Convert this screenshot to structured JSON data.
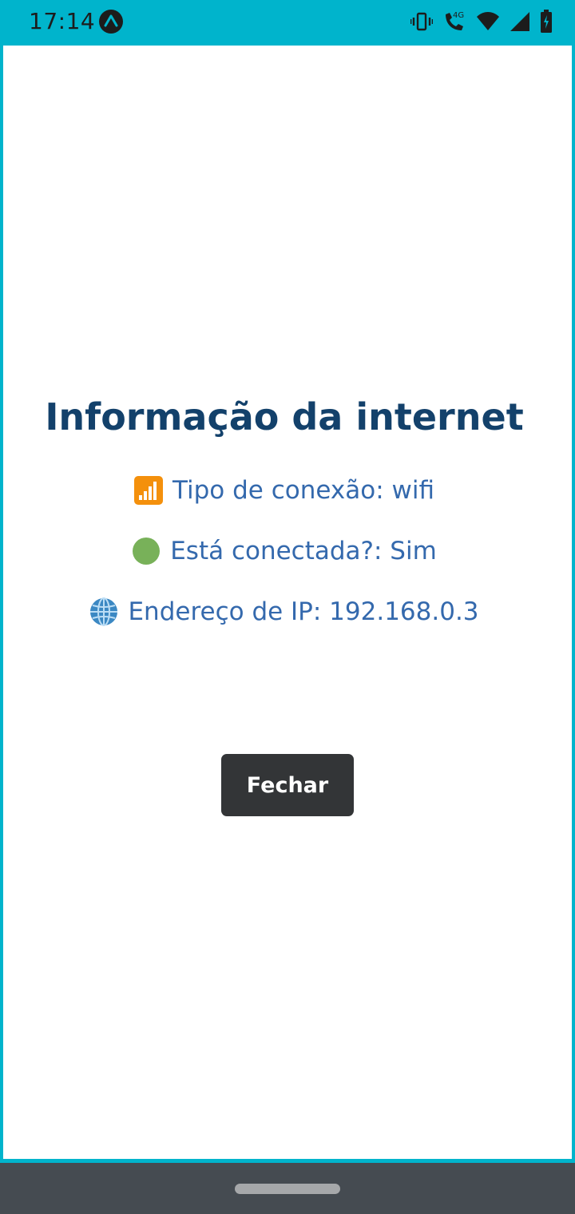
{
  "status_bar": {
    "time": "17:14",
    "network_label": "4G",
    "icons": [
      "expo-icon",
      "vibrate-icon",
      "call-4g-icon",
      "wifi-icon",
      "signal-icon",
      "battery-icon"
    ]
  },
  "screen": {
    "title": "Informação da internet",
    "lines": [
      {
        "icon": "signal-bars-emoji",
        "text": "Tipo de conexão: wifi"
      },
      {
        "icon": "green-circle-emoji",
        "text": "Está conectada?: Sim"
      },
      {
        "icon": "globe-emoji",
        "text": "Endereço de IP: 192.168.0.3"
      }
    ],
    "close_button_label": "Fechar"
  },
  "colors": {
    "status_bar_bg": "#00b4cc",
    "title": "#13416b",
    "info_text": "#3469ad",
    "button_bg": "#333537",
    "nav_bar_bg": "#454b51"
  }
}
